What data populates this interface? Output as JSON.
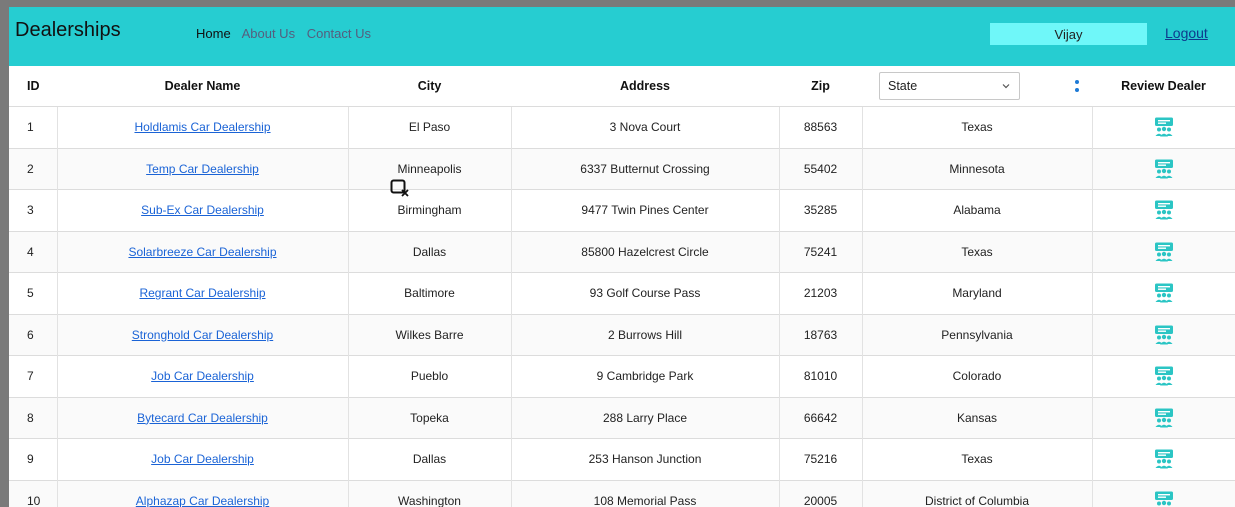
{
  "header": {
    "brand": "Dealerships",
    "nav": [
      {
        "label": "Home"
      },
      {
        "label": "About Us"
      },
      {
        "label": "Contact Us"
      }
    ],
    "username": "Vijay",
    "logout_label": "Logout",
    "colors": {
      "bar": "#26cdd1",
      "user_box": "#6ff7f9"
    }
  },
  "table": {
    "columns": {
      "id": "ID",
      "name": "Dealer Name",
      "city": "City",
      "address": "Address",
      "zip": "Zip",
      "state_select": "State",
      "review": "Review Dealer"
    },
    "review_icon": "review-people-icon",
    "rows": [
      {
        "id": "1",
        "name": "Holdlamis Car Dealership",
        "city": "El Paso",
        "address": "3 Nova Court",
        "zip": "88563",
        "state": "Texas"
      },
      {
        "id": "2",
        "name": "Temp Car Dealership",
        "city": "Minneapolis",
        "address": "6337 Butternut Crossing",
        "zip": "55402",
        "state": "Minnesota"
      },
      {
        "id": "3",
        "name": "Sub-Ex Car Dealership",
        "city": "Birmingham",
        "address": "9477 Twin Pines Center",
        "zip": "35285",
        "state": "Alabama"
      },
      {
        "id": "4",
        "name": "Solarbreeze Car Dealership",
        "city": "Dallas",
        "address": "85800 Hazelcrest Circle",
        "zip": "75241",
        "state": "Texas"
      },
      {
        "id": "5",
        "name": "Regrant Car Dealership",
        "city": "Baltimore",
        "address": "93 Golf Course Pass",
        "zip": "21203",
        "state": "Maryland"
      },
      {
        "id": "6",
        "name": "Stronghold Car Dealership",
        "city": "Wilkes Barre",
        "address": "2 Burrows Hill",
        "zip": "18763",
        "state": "Pennsylvania"
      },
      {
        "id": "7",
        "name": "Job Car Dealership",
        "city": "Pueblo",
        "address": "9 Cambridge Park",
        "zip": "81010",
        "state": "Colorado"
      },
      {
        "id": "8",
        "name": "Bytecard Car Dealership",
        "city": "Topeka",
        "address": "288 Larry Place",
        "zip": "66642",
        "state": "Kansas"
      },
      {
        "id": "9",
        "name": "Job Car Dealership",
        "city": "Dallas",
        "address": "253 Hanson Junction",
        "zip": "75216",
        "state": "Texas"
      },
      {
        "id": "10",
        "name": "Alphazap Car Dealership",
        "city": "Washington",
        "address": "108 Memorial Pass",
        "zip": "20005",
        "state": "District of Columbia"
      }
    ]
  }
}
